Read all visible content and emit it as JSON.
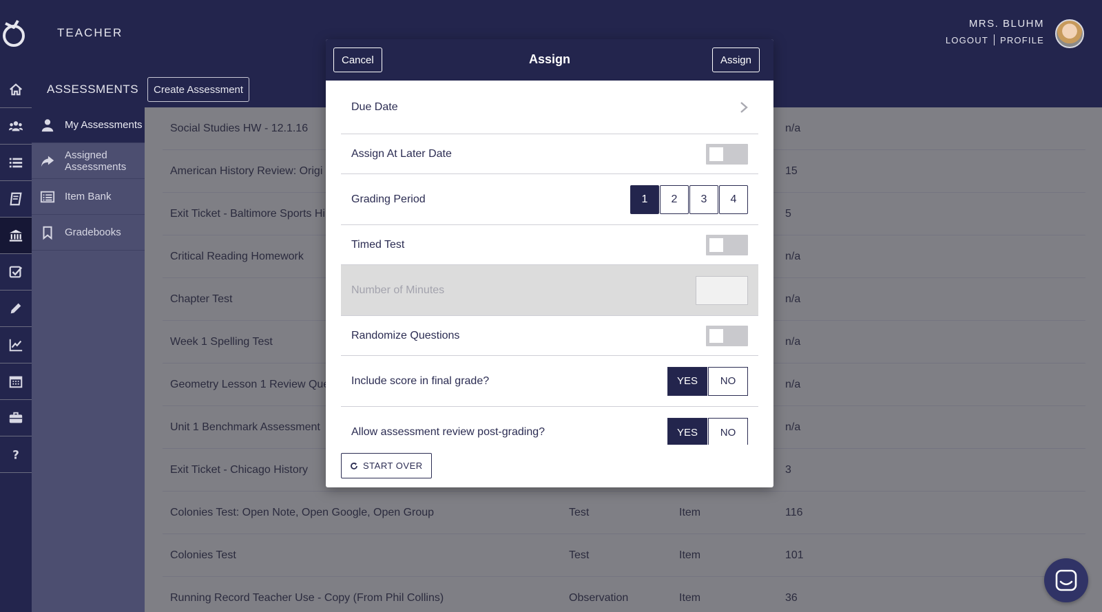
{
  "header": {
    "role": "TEACHER",
    "user_name": "MRS. BLUHM",
    "logout_label": "LOGOUT",
    "profile_label": "PROFILE"
  },
  "rail": {
    "icons": [
      "home-icon",
      "users-icon",
      "list-icon",
      "book-icon",
      "institution-icon",
      "checkbox-icon",
      "pencil-icon",
      "chart-icon",
      "calendar-icon",
      "briefcase-icon",
      "help-icon"
    ],
    "active": "institution-icon"
  },
  "section": {
    "title": "ASSESSMENTS",
    "create_label": "Create Assessment"
  },
  "subnav": {
    "items": [
      {
        "label": "My Assessments",
        "icon": "user-icon",
        "active": true
      },
      {
        "label": "Assigned Assessments",
        "icon": "share-icon",
        "active": false
      },
      {
        "label": "Item Bank",
        "icon": "list-box-icon",
        "active": false
      },
      {
        "label": "Gradebooks",
        "icon": "bookmark-icon",
        "active": false
      }
    ]
  },
  "assessments": [
    {
      "name": "Social Studies HW - 12.1.16",
      "type": "",
      "kind": "",
      "count": "n/a"
    },
    {
      "name": "American History Review: Origi",
      "type": "",
      "kind": "",
      "count": "15"
    },
    {
      "name": "Exit Ticket - Baltimore Sports Hi",
      "type": "",
      "kind": "",
      "count": "5"
    },
    {
      "name": "Critical Reading Homework",
      "type": "",
      "kind": "",
      "count": "n/a"
    },
    {
      "name": "Chapter Test",
      "type": "",
      "kind": "",
      "count": "n/a"
    },
    {
      "name": "Week 1 Spelling Test",
      "type": "",
      "kind": "",
      "count": "n/a"
    },
    {
      "name": "Geometry Lesson 1 Review Que",
      "type": "",
      "kind": "",
      "count": "n/a"
    },
    {
      "name": "Unit 1 Benchmark Assessment",
      "type": "",
      "kind": "",
      "count": "n/a"
    },
    {
      "name": "Exit Ticket - Chicago History",
      "type": "",
      "kind": "",
      "count": "3"
    },
    {
      "name": " Colonies Test: Open Note, Open Google, Open Group",
      "type": "Test",
      "kind": "Item",
      "count": "116"
    },
    {
      "name": "Colonies Test",
      "type": "Test",
      "kind": "Item",
      "count": "101"
    },
    {
      "name": "Running Record Teacher Use - Copy (From Phil Collins)",
      "type": "Observation",
      "kind": "Item",
      "count": "36"
    }
  ],
  "modal": {
    "title": "Assign",
    "cancel_label": "Cancel",
    "assign_label": "Assign",
    "due_date_label": "Due Date",
    "later_date_label": "Assign At Later Date",
    "later_date_on": false,
    "grading_period_label": "Grading Period",
    "grading_periods": [
      "1",
      "2",
      "3",
      "4"
    ],
    "grading_period_selected": "1",
    "timed_test_label": "Timed Test",
    "timed_test_on": false,
    "minutes_label": "Number of Minutes",
    "minutes_value": "",
    "randomize_label": "Randomize Questions",
    "randomize_on": false,
    "include_score_label": "Include score in final grade?",
    "include_score_selected": "YES",
    "allow_review_label": "Allow assessment review post-grading?",
    "allow_review_selected": "YES",
    "yes_label": "YES",
    "no_label": "NO",
    "start_over_label": "START OVER"
  },
  "colors": {
    "navy": "#23254d",
    "overlay_gray": "#7f7f85",
    "subnav": "#4c4e70"
  }
}
